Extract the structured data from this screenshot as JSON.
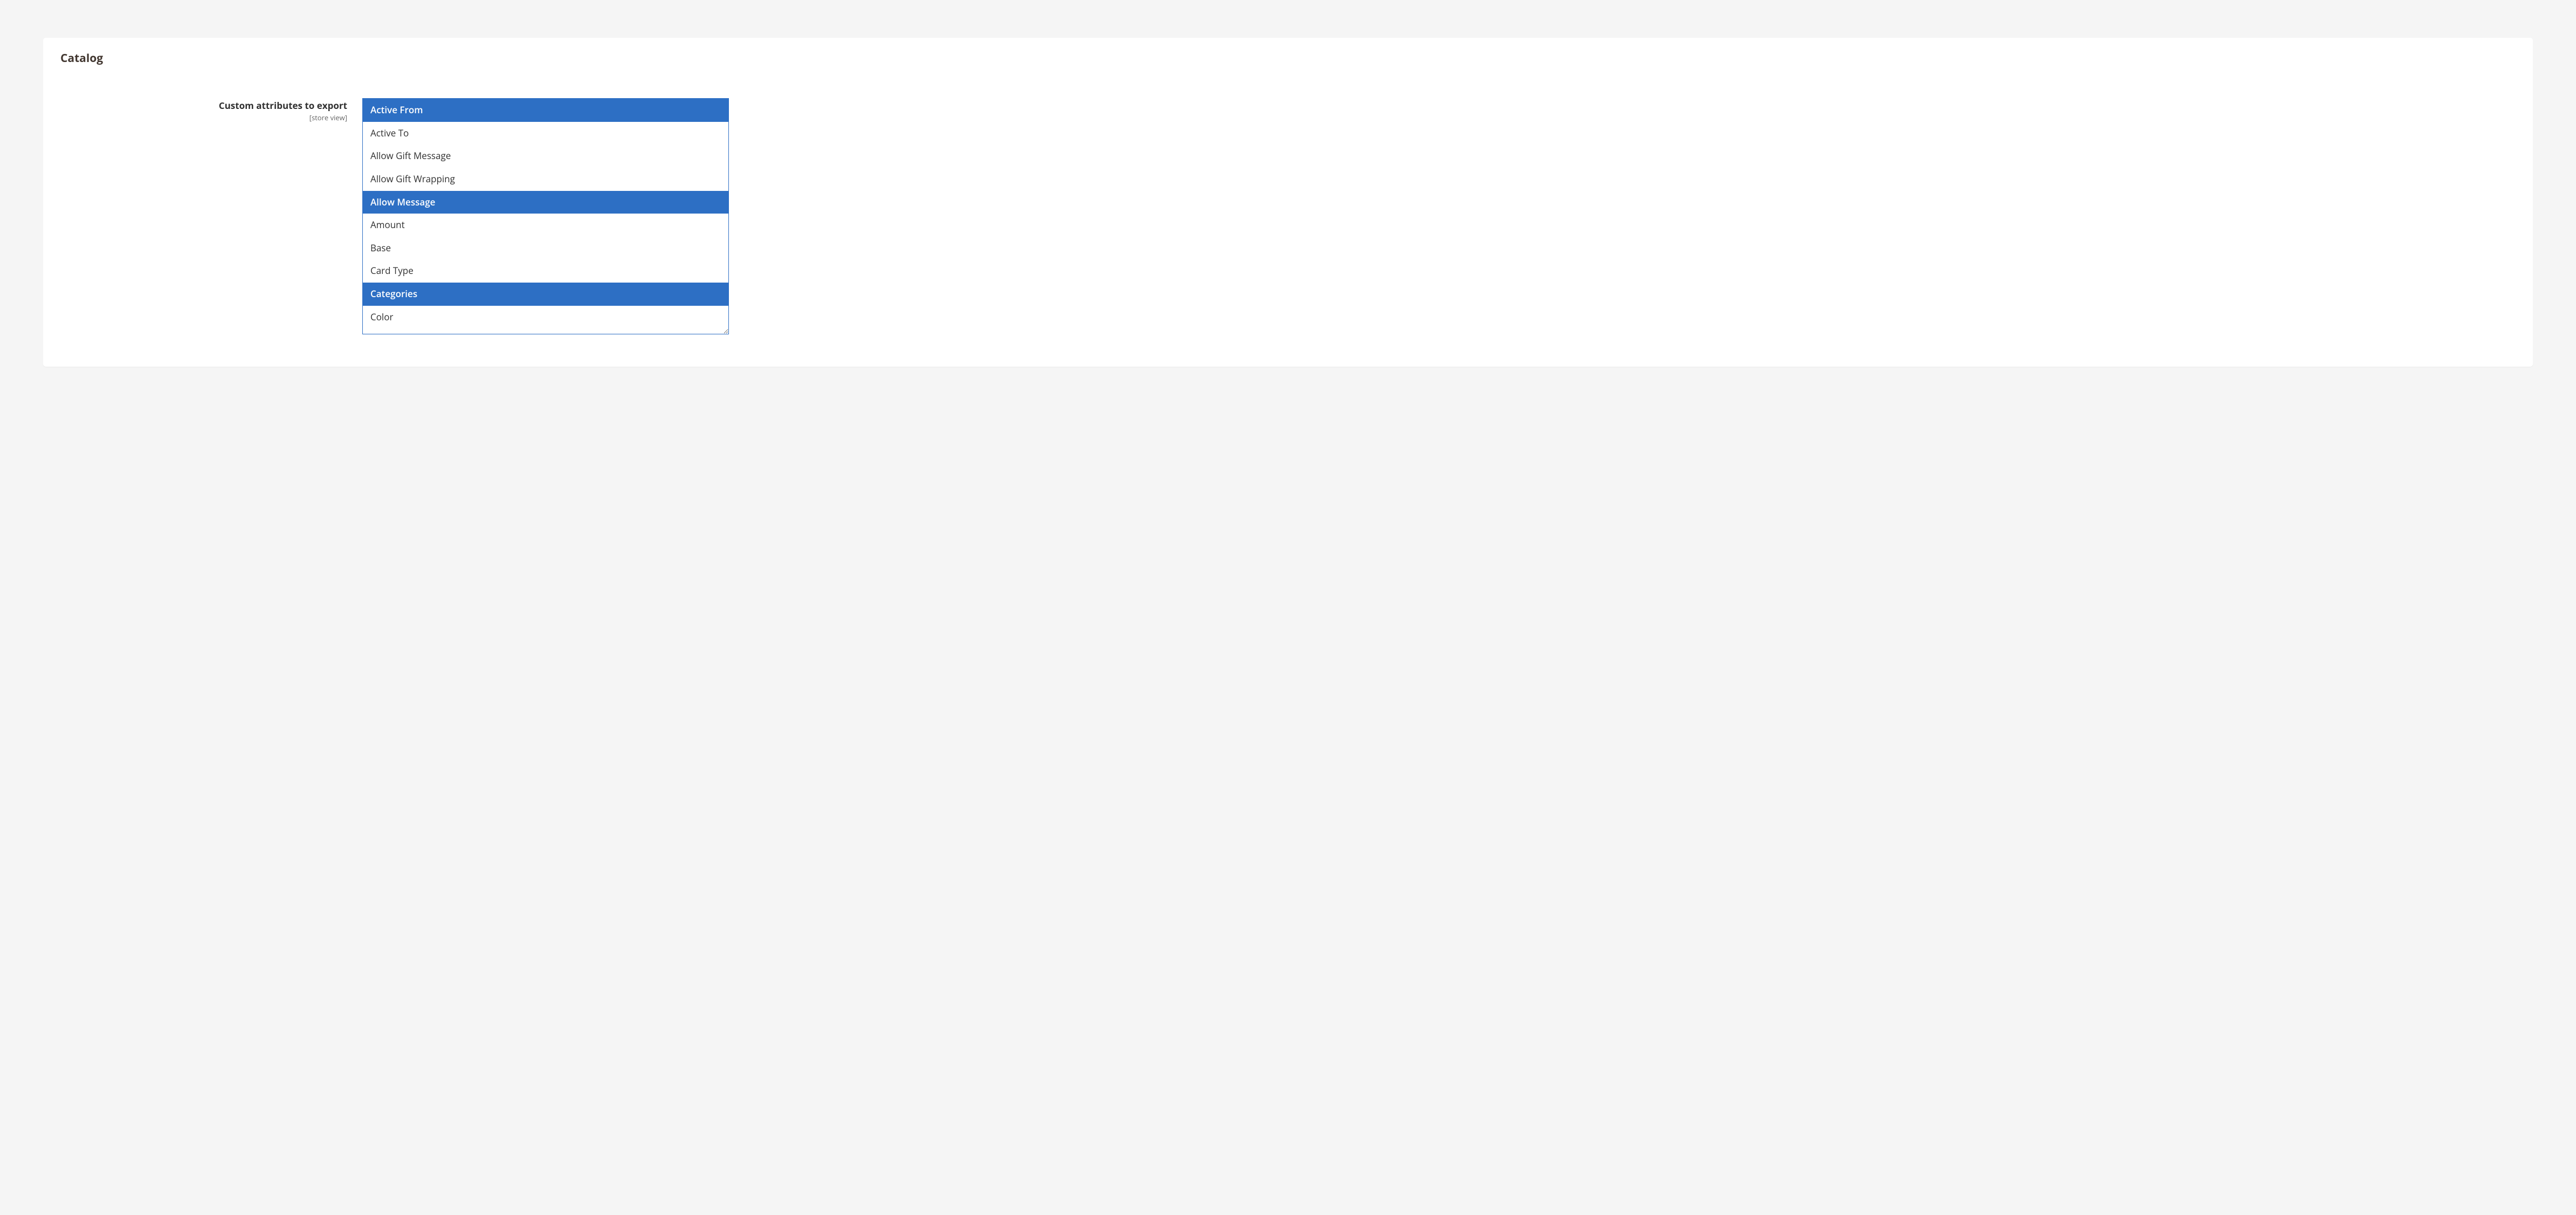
{
  "section": {
    "title": "Catalog"
  },
  "field": {
    "label": "Custom attributes to export",
    "scope": "[store view]"
  },
  "options": {
    "0": {
      "label": "Active From",
      "selected": true
    },
    "1": {
      "label": "Active To",
      "selected": false
    },
    "2": {
      "label": "Allow Gift Message",
      "selected": false
    },
    "3": {
      "label": "Allow Gift Wrapping",
      "selected": false
    },
    "4": {
      "label": "Allow Message",
      "selected": true
    },
    "5": {
      "label": "Amount",
      "selected": false
    },
    "6": {
      "label": "Base",
      "selected": false
    },
    "7": {
      "label": "Card Type",
      "selected": false
    },
    "8": {
      "label": "Categories",
      "selected": true
    },
    "9": {
      "label": "Color",
      "selected": false
    }
  }
}
